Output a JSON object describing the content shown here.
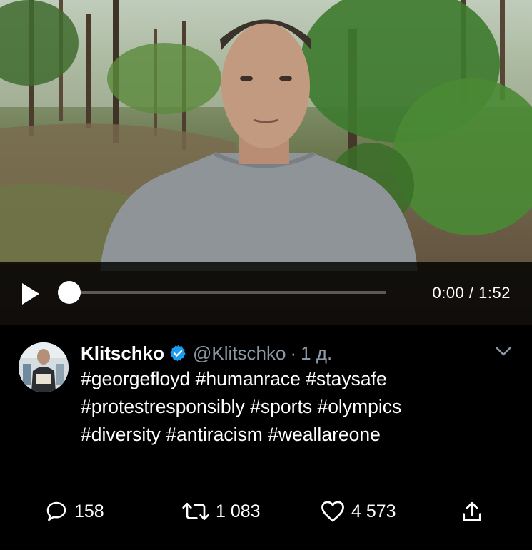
{
  "video": {
    "current_time": "0:00",
    "separator": "/",
    "duration": "1:52",
    "progress": 0.0
  },
  "tweet": {
    "display_name": "Klitschko",
    "handle": "@Klitschko",
    "dot": "·",
    "time_ago": "1 д.",
    "hashtags_line1": [
      "#georgefloyd",
      "#humanrace",
      "#staysafe"
    ],
    "hashtags_line2": [
      "#protestresponsibly",
      "#sports",
      "#olympics"
    ],
    "hashtags_line3": [
      "#diversity",
      "#antiracism",
      "#weallareone"
    ]
  },
  "actions": {
    "replies": "158",
    "retweets": "1 083",
    "likes": "4 573"
  },
  "colors": {
    "background": "#000000",
    "secondary_text": "#8b98a5",
    "verified_badge": "#1d9bf0",
    "scrub_track": "#5a5a5a"
  },
  "icons": {
    "play": "play-icon",
    "verified": "verified-badge-icon",
    "chevron": "chevron-down-icon",
    "reply": "reply-icon",
    "retweet": "retweet-icon",
    "like": "heart-icon",
    "share": "share-icon"
  }
}
